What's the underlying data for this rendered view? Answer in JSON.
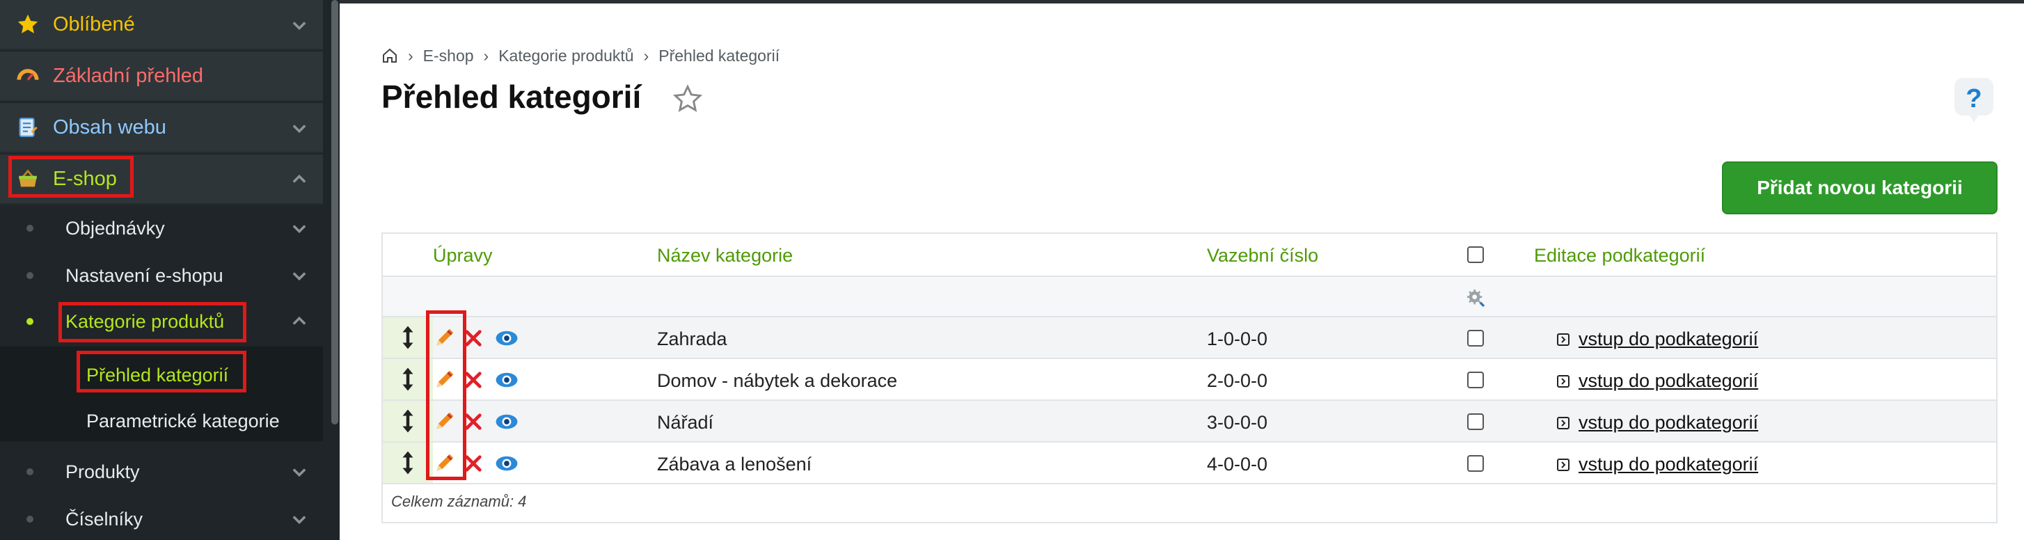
{
  "colors": {
    "sidebar_bg": "#1f2528",
    "accent_green": "#4e9a06",
    "button_green": "#2f9a2c",
    "highlight_red": "#e01919",
    "link_lime": "#b5e61d"
  },
  "sidebar": {
    "top_items": [
      {
        "label": "Oblíbené",
        "icon": "star-icon",
        "color": "#f5c400"
      },
      {
        "label": "Základní přehled",
        "icon": "gauge-icon",
        "color": "#ff6b6b"
      },
      {
        "label": "Obsah webu",
        "icon": "document-icon",
        "color": "#8ec9ff"
      },
      {
        "label": "E-shop",
        "icon": "basket-icon",
        "color": "#b5e61d"
      }
    ],
    "eshop_items": [
      {
        "label": "Objednávky"
      },
      {
        "label": "Nastavení e-shopu"
      },
      {
        "label": "Kategorie produktů"
      },
      {
        "label": "Produkty"
      },
      {
        "label": "Číselníky"
      }
    ],
    "category_subitems": [
      {
        "label": "Přehled kategorií"
      },
      {
        "label": "Parametrické kategorie"
      }
    ]
  },
  "breadcrumb": {
    "home_icon": "home-icon",
    "items": [
      "E-shop",
      "Kategorie produktů",
      "Přehled kategorií"
    ]
  },
  "page": {
    "title": "Přehled kategorií",
    "add_button": "Přidat novou kategorii"
  },
  "table": {
    "headers": {
      "edits": "Úpravy",
      "name": "Název kategorie",
      "code": "Vazební číslo",
      "subcats": "Editace podkategorií"
    },
    "rows": [
      {
        "name": "Zahrada",
        "code": "1-0-0-0",
        "link": "vstup do podkategorií"
      },
      {
        "name": "Domov - nábytek a dekorace",
        "code": "2-0-0-0",
        "link": "vstup do podkategorií"
      },
      {
        "name": "Nářadí",
        "code": "3-0-0-0",
        "link": "vstup do podkategorií"
      },
      {
        "name": "Zábava a lenošení",
        "code": "4-0-0-0",
        "link": "vstup do podkategorií"
      }
    ],
    "footer": "Celkem záznamů: 4"
  }
}
